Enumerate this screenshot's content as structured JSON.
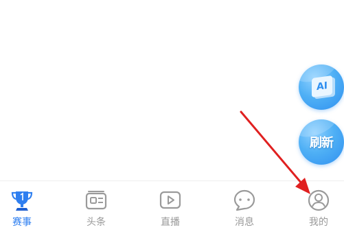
{
  "floating_buttons": {
    "ai_label": "AI",
    "refresh_label": "刷新"
  },
  "tabbar": {
    "active_color": "#2f7ff0",
    "inactive_color": "#999999",
    "items": [
      {
        "label": "赛事",
        "icon": "trophy-icon",
        "active": true
      },
      {
        "label": "头条",
        "icon": "news-icon",
        "active": false
      },
      {
        "label": "直播",
        "icon": "play-icon",
        "active": false
      },
      {
        "label": "消息",
        "icon": "chat-bubble-icon",
        "active": false
      },
      {
        "label": "我的",
        "icon": "profile-icon",
        "active": false
      }
    ]
  },
  "annotation": {
    "arrow_color": "#e02020",
    "target": "我的"
  }
}
